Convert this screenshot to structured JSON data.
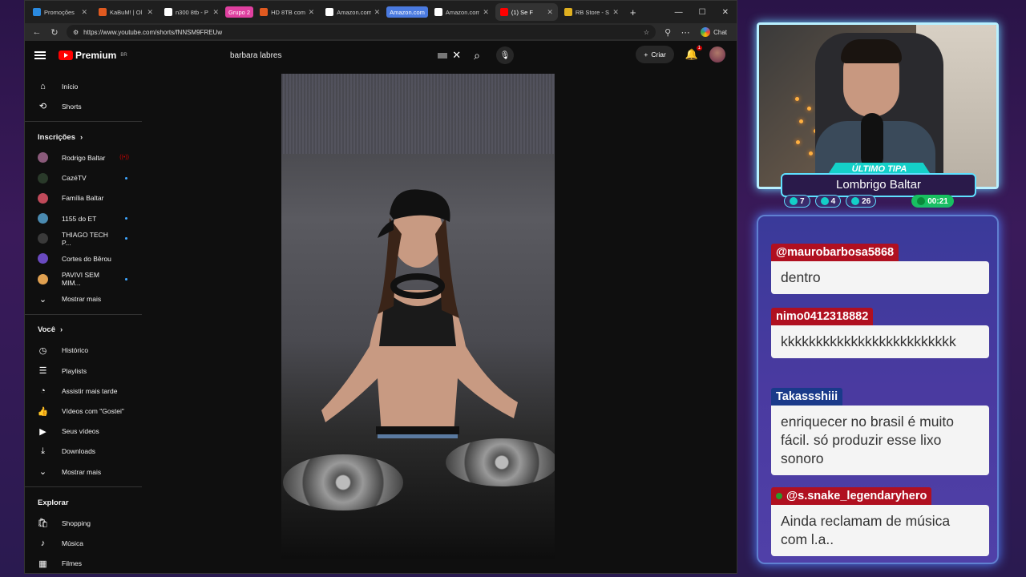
{
  "browser": {
    "tabs": [
      {
        "label": "Promoções",
        "color": "#2a8ae0"
      },
      {
        "label": "KaBuM! | Ol",
        "color": "#e05a20"
      },
      {
        "label": "n300 8tb - P",
        "color": "#ffffff"
      },
      {
        "group": "Grupo 2",
        "group_color": "#e040a0"
      },
      {
        "label": "HD 8TB com",
        "color": "#e05a20"
      },
      {
        "label": "Amazon.com",
        "color": "#ffffff"
      },
      {
        "group": "Amazon.com",
        "group_color": "#4a7ae0"
      },
      {
        "label": "Amazon.com",
        "color": "#ffffff"
      },
      {
        "label": "(1) Se F",
        "color": "#ff0000",
        "active": true
      },
      {
        "label": "RB Store - S",
        "color": "#e0b020"
      }
    ],
    "url": "https://www.youtube.com/shorts/fNNSM9FREUw",
    "chat_label": "Chat"
  },
  "youtube": {
    "logo_text": "Premium",
    "logo_region": "BR",
    "search_value": "barbara labres",
    "create_label": "Criar",
    "notif_count": "1",
    "sidebar": {
      "main": [
        {
          "label": "Início",
          "icon": "home-icon",
          "glyph": "⌂"
        },
        {
          "label": "Shorts",
          "icon": "shorts-icon",
          "glyph": "⟲"
        }
      ],
      "subscriptions_title": "Inscrições",
      "subscriptions": [
        {
          "label": "Rodrigo Baltar",
          "color": "#8a5a7a",
          "status": "live"
        },
        {
          "label": "CazéTV",
          "color": "#2a3a2a",
          "status": "dot"
        },
        {
          "label": "Família Baltar",
          "color": "#c04a5a",
          "status": ""
        },
        {
          "label": "1155 do ET",
          "color": "#4a8ab0",
          "status": "dot"
        },
        {
          "label": "THIAGO TECH P...",
          "color": "#3a3a3a",
          "status": "dot"
        },
        {
          "label": "Cortes do Bêrou",
          "color": "#6a4ac0",
          "status": ""
        },
        {
          "label": "PAVIVI SEM MIM...",
          "color": "#e0a050",
          "status": "dot"
        }
      ],
      "show_more": "Mostrar mais",
      "you_title": "Você",
      "you": [
        {
          "label": "Histórico",
          "icon": "history-icon",
          "glyph": "◷"
        },
        {
          "label": "Playlists",
          "icon": "playlists-icon",
          "glyph": "☰"
        },
        {
          "label": "Assistir mais tarde",
          "icon": "watch-later-icon",
          "glyph": "◔"
        },
        {
          "label": "Vídeos com \"Gostei\"",
          "icon": "like-icon",
          "glyph": "👍"
        },
        {
          "label": "Seus vídeos",
          "icon": "your-videos-icon",
          "glyph": "▶"
        },
        {
          "label": "Downloads",
          "icon": "download-icon",
          "glyph": "⤓"
        }
      ],
      "show_more_2": "Mostrar mais",
      "explore_title": "Explorar",
      "explore": [
        {
          "label": "Shopping",
          "icon": "shopping-icon",
          "glyph": "🛍"
        },
        {
          "label": "Música",
          "icon": "music-icon",
          "glyph": "♪"
        },
        {
          "label": "Filmes",
          "icon": "movies-icon",
          "glyph": "▦"
        }
      ]
    }
  },
  "overlay": {
    "tipa_label": "ÚLTIMO TIPA",
    "tipa_name": "Lombrigo Baltar",
    "stats": [
      {
        "value": "7",
        "icon": "chat-icon"
      },
      {
        "value": "4",
        "icon": "youtube-icon"
      },
      {
        "value": "26",
        "icon": "viewers-icon"
      },
      {
        "value": "00:21",
        "icon": "clock-icon",
        "green": true
      }
    ],
    "chat": [
      {
        "author": "@maurobarbosa5868",
        "text": "dentro",
        "color": "red"
      },
      {
        "author": "nimo0412318882",
        "text": "kkkkkkkkkkkkkkkkkkkkkkkkk",
        "color": "red"
      },
      {
        "author": "Takassshiii",
        "text": "enriquecer no brasil é muito fácil. só produzir esse lixo sonoro",
        "color": "blue"
      },
      {
        "author": "@s.snake_legendaryhero",
        "text": "Ainda reclamam de música com l.a..",
        "color": "red"
      }
    ]
  }
}
